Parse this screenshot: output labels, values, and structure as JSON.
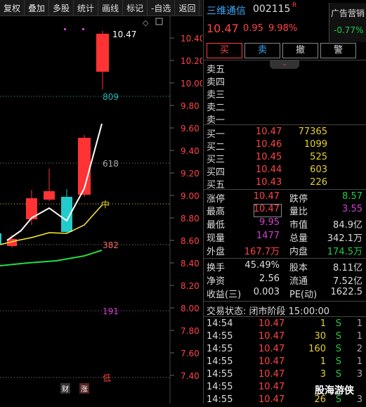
{
  "toolbar": {
    "buttons": [
      "复权",
      "叠加",
      "多股",
      "统计",
      "画线",
      "标记",
      "-自选",
      "返回"
    ]
  },
  "chart": {
    "y_axis_labels": [
      "10.40",
      "10.20",
      "10.00",
      "9.80",
      "9.60",
      "9.40",
      "9.20",
      "9.00",
      "8.80",
      "8.60",
      "8.40",
      "8.20",
      "8.00",
      "7.80",
      "7.60",
      "7.40"
    ],
    "high_label": "10.47",
    "volume_labels": [
      "809",
      "618",
      "382",
      "191"
    ],
    "marker_zhong": "中",
    "marker_di": "低",
    "badge_cai": "财",
    "badge_zhang": "涨",
    "colors": {
      "up": "#ff3333",
      "down": "#22cccc",
      "ma_white": "#ffffff",
      "ma_yellow": "#ffee33",
      "ma_green": "#22dd44"
    }
  },
  "header": {
    "name": "三维通信",
    "code": "002115",
    "r_mark": "R",
    "ad_label": "广告营销",
    "ad_value": "-0.77%",
    "price": "10.47",
    "change": "0.95",
    "change_pct": "9.98%"
  },
  "trade_buttons": {
    "buy": "买",
    "sell": "卖",
    "cancel": "撤",
    "alert": "警"
  },
  "collapse_icon": "⌄",
  "order_book": {
    "asks": [
      {
        "label": "卖五",
        "price": "",
        "vol": ""
      },
      {
        "label": "卖四",
        "price": "",
        "vol": ""
      },
      {
        "label": "卖三",
        "price": "",
        "vol": ""
      },
      {
        "label": "卖二",
        "price": "",
        "vol": ""
      },
      {
        "label": "卖一",
        "price": "",
        "vol": ""
      }
    ],
    "bids": [
      {
        "label": "买一",
        "price": "10.47",
        "vol": "77365"
      },
      {
        "label": "买二",
        "price": "10.46",
        "vol": "1099"
      },
      {
        "label": "买三",
        "price": "10.45",
        "vol": "525"
      },
      {
        "label": "买四",
        "price": "10.44",
        "vol": "603"
      },
      {
        "label": "买五",
        "price": "10.43",
        "vol": "226"
      }
    ]
  },
  "stats": {
    "zhangting": {
      "label": "涨停",
      "value": "10.47"
    },
    "dieting": {
      "label": "跌停",
      "value": "8.57"
    },
    "zuigao": {
      "label": "最高",
      "value": "10.47"
    },
    "liangbi": {
      "label": "量比",
      "value": "3.55"
    },
    "zuidi": {
      "label": "最低",
      "value": "9.95"
    },
    "shizhi": {
      "label": "市值",
      "value": "84.9亿"
    },
    "xianliang": {
      "label": "现量",
      "value": "1477"
    },
    "zongliang": {
      "label": "总量",
      "value": "342.1万"
    },
    "waipan": {
      "label": "外盘",
      "value": "167.7万"
    },
    "neipan": {
      "label": "内盘",
      "value": "174.5万"
    },
    "huanshou": {
      "label": "换手",
      "value": "45.49%"
    },
    "guben": {
      "label": "股本",
      "value": "8.11亿"
    },
    "jingzi": {
      "label": "净资",
      "value": "2.56"
    },
    "liutong": {
      "label": "流通",
      "value": "7.52亿"
    },
    "shouyi": {
      "label": "收益(三)",
      "value": "0.003"
    },
    "pe": {
      "label": "PE(动)",
      "value": "1622.5"
    }
  },
  "trade_status": "交易状态: 闭市阶段 15:00:00",
  "ticks": [
    {
      "time": "14:54",
      "price": "10.47",
      "vol": "1",
      "side": "S",
      "n": "1"
    },
    {
      "time": "14:55",
      "price": "10.47",
      "vol": "30",
      "side": "S",
      "n": "1"
    },
    {
      "time": "14:55",
      "price": "10.47",
      "vol": "160",
      "side": "S",
      "n": "2"
    },
    {
      "time": "14:55",
      "price": "10.47",
      "vol": "1",
      "side": "S",
      "n": "1"
    },
    {
      "time": "14:55",
      "price": "10.47",
      "vol": "3",
      "side": "S",
      "n": "3"
    },
    {
      "time": "14:55",
      "price": "10.47",
      "vol": "",
      "side": "",
      "n": ""
    },
    {
      "time": "14:55",
      "price": "10.47",
      "vol": "26",
      "side": "S",
      "n": "3"
    }
  ],
  "watermark": "股海游侠"
}
